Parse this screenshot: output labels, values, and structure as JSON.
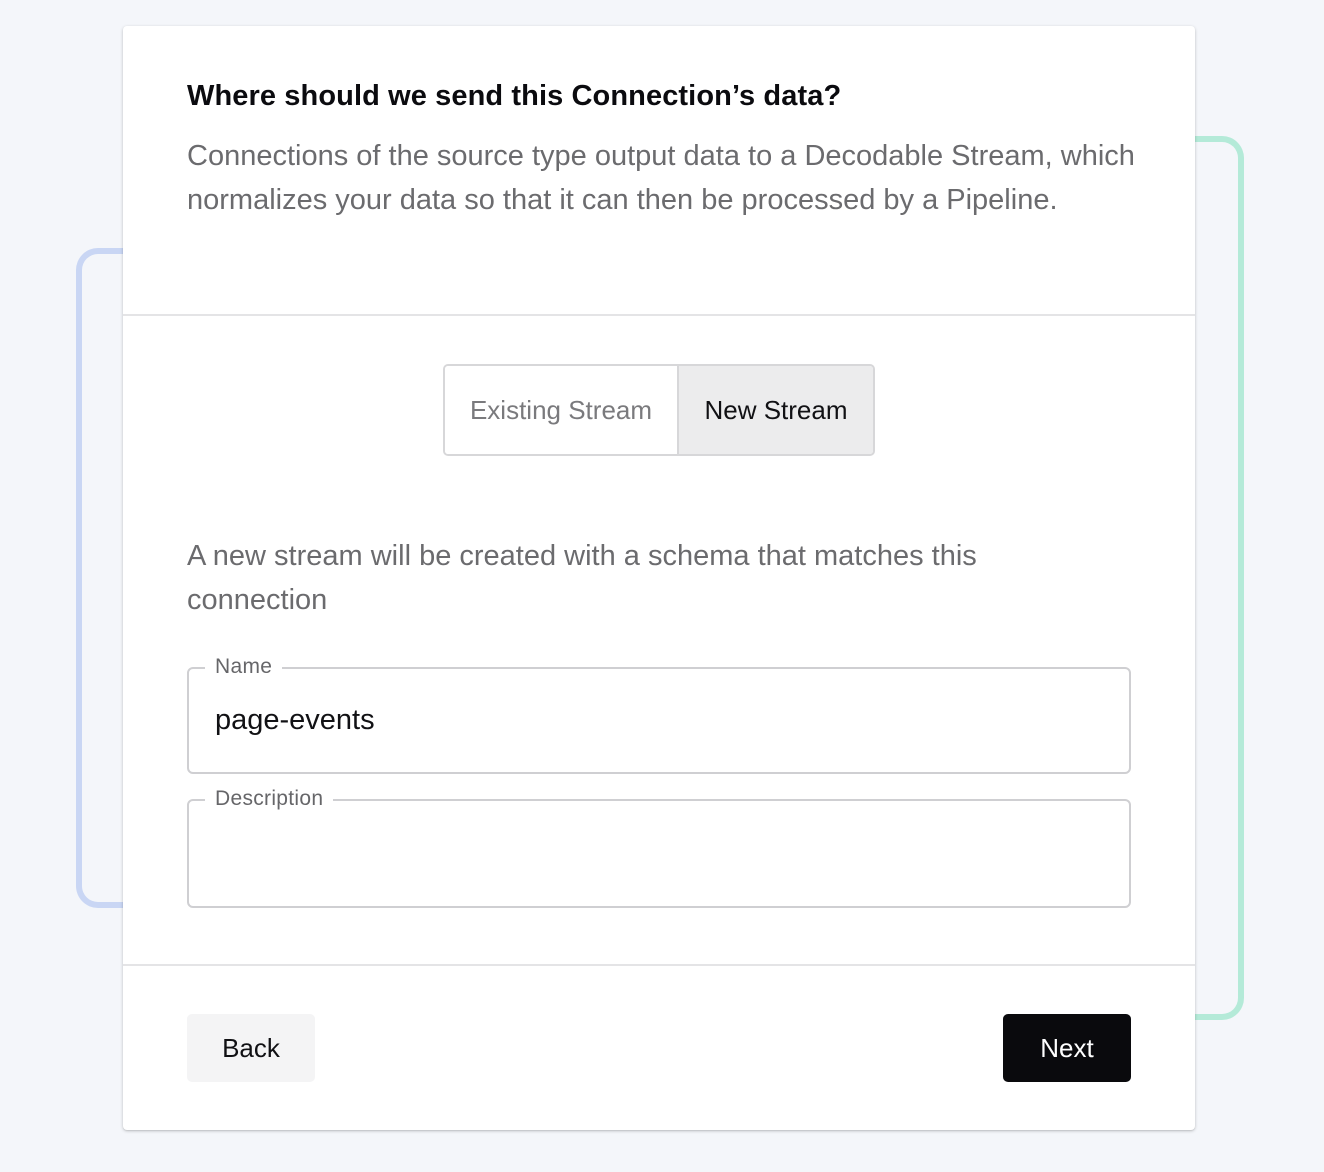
{
  "dialog": {
    "title": "Where should we send this Connection’s data?",
    "intro": "Connections of the source type output data to a Decodable Stream, which normalizes your data so that it can then be processed by a Pipeline."
  },
  "stream_toggle": {
    "options": [
      {
        "label": "Existing Stream",
        "selected": false
      },
      {
        "label": "New Stream",
        "selected": true
      }
    ]
  },
  "new_stream": {
    "helper_text": "A new stream will be created with a schema that matches this connection",
    "name_field": {
      "label": "Name",
      "value": "page-events"
    },
    "description_field": {
      "label": "Description",
      "value": ""
    }
  },
  "footer": {
    "back_label": "Back",
    "next_label": "Next"
  },
  "colors": {
    "page_background": "#f4f6fa",
    "accent_left": "#c9d6f4",
    "accent_right": "#b4ead8",
    "primary_button": "#0a0a0d",
    "selected_toggle": "#ececed"
  }
}
